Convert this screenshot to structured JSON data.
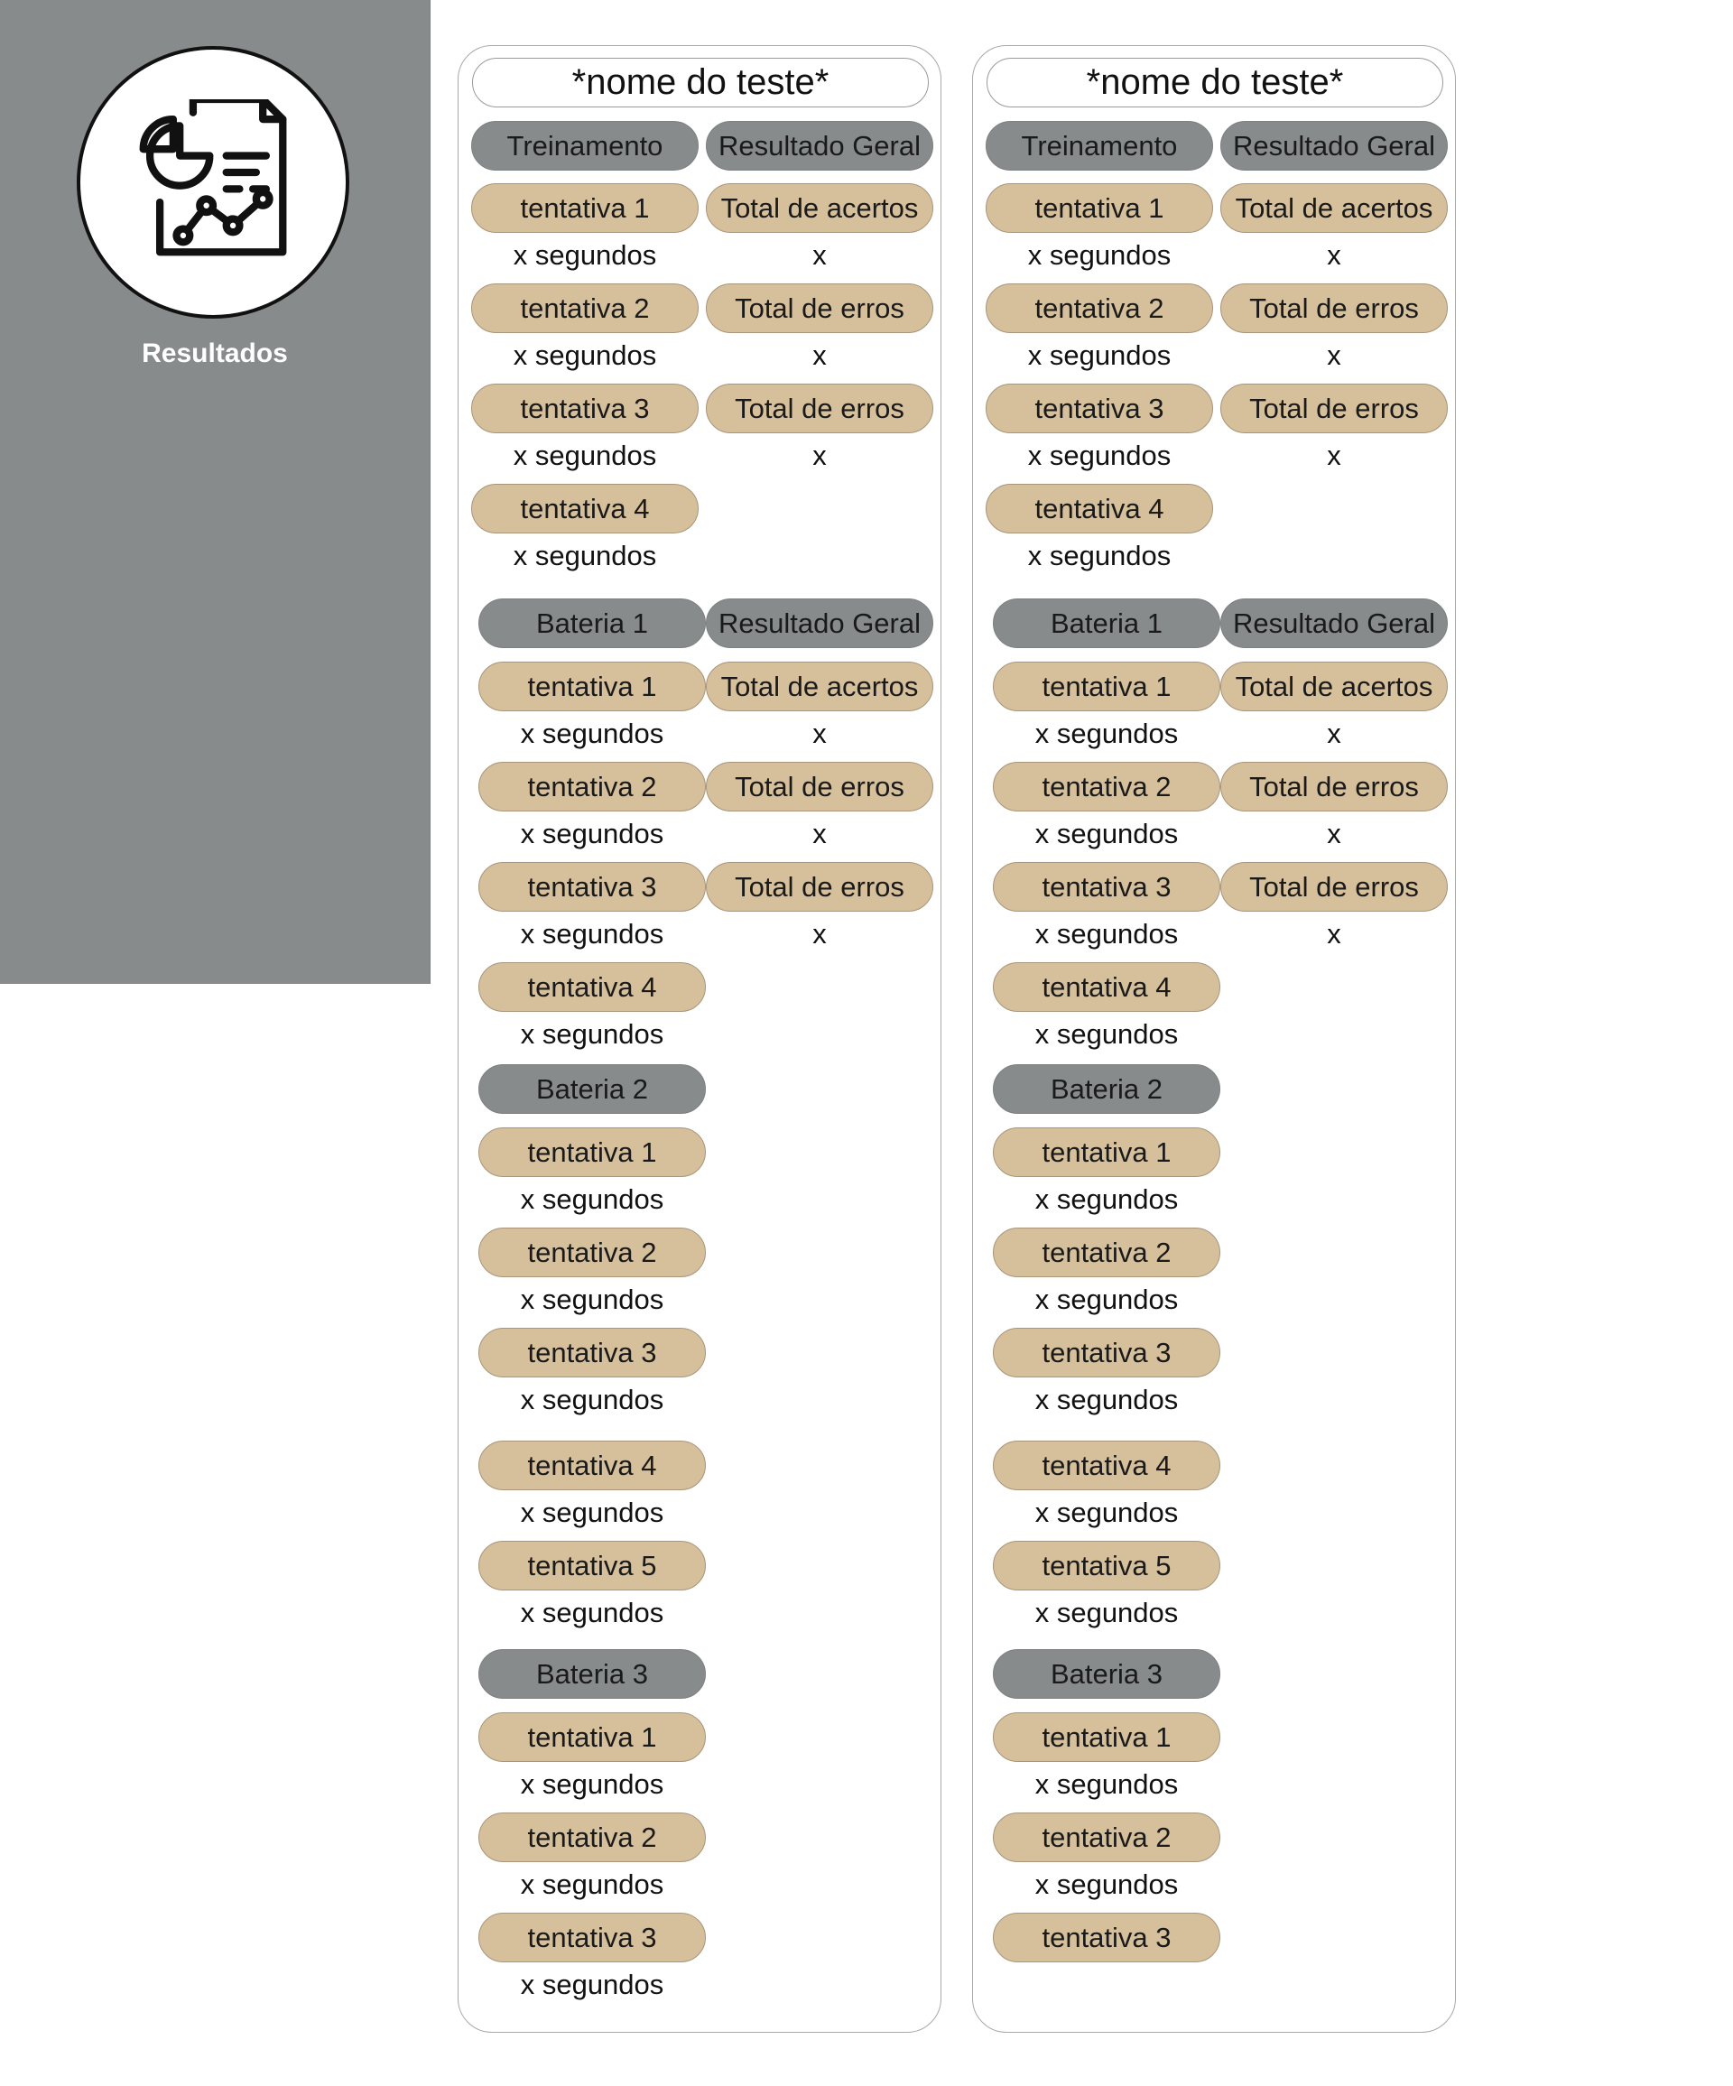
{
  "sidebar": {
    "label": "Resultados",
    "icon": "report-analytics-icon"
  },
  "colors": {
    "sidebar_bg": "#878b8b",
    "header_pill": "#878b8b",
    "attempt_pill": "#d6bf9b"
  },
  "cards": [
    {
      "title": "*nome do teste*",
      "sections": [
        {
          "name": "Treinamento",
          "summary_label": "Resultado Geral",
          "attempts": [
            {
              "label": "tentativa 1",
              "time": "x segundos"
            },
            {
              "label": "tentativa 2",
              "time": "x segundos"
            },
            {
              "label": "tentativa 3",
              "time": "x segundos"
            },
            {
              "label": "tentativa 4",
              "time": "x segundos"
            }
          ],
          "summary": [
            {
              "label": "Total de acertos",
              "value": "x"
            },
            {
              "label": "Total de erros",
              "value": "x"
            },
            {
              "label": "Total de erros",
              "value": "x"
            }
          ]
        },
        {
          "name": "Bateria 1",
          "summary_label": "Resultado Geral",
          "attempts": [
            {
              "label": "tentativa 1",
              "time": "x segundos"
            },
            {
              "label": "tentativa 2",
              "time": "x segundos"
            },
            {
              "label": "tentativa 3",
              "time": "x segundos"
            },
            {
              "label": "tentativa 4",
              "time": "x segundos"
            }
          ],
          "summary": [
            {
              "label": "Total de acertos",
              "value": "x"
            },
            {
              "label": "Total de erros",
              "value": "x"
            },
            {
              "label": "Total de erros",
              "value": "x"
            }
          ]
        },
        {
          "name": "Bateria 2",
          "attempts": [
            {
              "label": "tentativa 1",
              "time": "x segundos"
            },
            {
              "label": "tentativa 2",
              "time": "x segundos"
            },
            {
              "label": "tentativa 3",
              "time": "x segundos"
            },
            {
              "label": "tentativa 4",
              "time": "x segundos"
            },
            {
              "label": "tentativa 5",
              "time": "x segundos"
            }
          ]
        },
        {
          "name": "Bateria 3",
          "attempts": [
            {
              "label": "tentativa 1",
              "time": "x segundos"
            },
            {
              "label": "tentativa 2",
              "time": "x segundos"
            },
            {
              "label": "tentativa 3",
              "time": "x segundos"
            }
          ]
        }
      ]
    },
    {
      "title": "*nome do teste*",
      "sections": [
        {
          "name": "Treinamento",
          "summary_label": "Resultado Geral",
          "attempts": [
            {
              "label": "tentativa 1",
              "time": "x segundos"
            },
            {
              "label": "tentativa 2",
              "time": "x segundos"
            },
            {
              "label": "tentativa 3",
              "time": "x segundos"
            },
            {
              "label": "tentativa 4",
              "time": "x segundos"
            }
          ],
          "summary": [
            {
              "label": "Total de acertos",
              "value": "x"
            },
            {
              "label": "Total de erros",
              "value": "x"
            },
            {
              "label": "Total de erros",
              "value": "x"
            }
          ]
        },
        {
          "name": "Bateria 1",
          "summary_label": "Resultado Geral",
          "attempts": [
            {
              "label": "tentativa 1",
              "time": "x segundos"
            },
            {
              "label": "tentativa 2",
              "time": "x segundos"
            },
            {
              "label": "tentativa 3",
              "time": "x segundos"
            },
            {
              "label": "tentativa 4",
              "time": "x segundos"
            }
          ],
          "summary": [
            {
              "label": "Total de acertos",
              "value": "x"
            },
            {
              "label": "Total de erros",
              "value": "x"
            },
            {
              "label": "Total de erros",
              "value": "x"
            }
          ]
        },
        {
          "name": "Bateria 2",
          "attempts": [
            {
              "label": "tentativa 1",
              "time": "x segundos"
            },
            {
              "label": "tentativa 2",
              "time": "x segundos"
            },
            {
              "label": "tentativa 3",
              "time": "x segundos"
            },
            {
              "label": "tentativa 4",
              "time": "x segundos"
            },
            {
              "label": "tentativa 5",
              "time": "x segundos"
            }
          ]
        },
        {
          "name": "Bateria 3",
          "attempts": [
            {
              "label": "tentativa 1",
              "time": "x segundos"
            },
            {
              "label": "tentativa 2",
              "time": "x segundos"
            },
            {
              "label": "tentativa 3"
            }
          ]
        }
      ]
    }
  ]
}
